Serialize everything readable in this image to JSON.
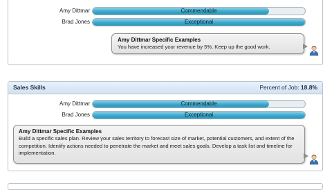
{
  "top_section": {
    "ratings": [
      {
        "name": "Amy Dittmar",
        "rating": "Commendable",
        "level": 0.83
      },
      {
        "name": "Brad Jones",
        "rating": "Exceptional",
        "level": 1.0
      }
    ],
    "comment": {
      "title": "Amy Dittmar Specific Examples",
      "text": "You have increased your revenue by 5%. Keep up the good work."
    }
  },
  "sales_section": {
    "title": "Sales Skills",
    "percent_label": "Percent of Job:",
    "percent_value": "18.8%",
    "ratings": [
      {
        "name": "Amy Dittmar",
        "rating": "Commendable",
        "level": 0.83
      },
      {
        "name": "Brad Jones",
        "rating": "Exceptional",
        "level": 1.0
      }
    ],
    "comment": {
      "title": "Amy Dittmar Specific Examples",
      "text": "Build a specific sales plan. Review your sales territory to forecast size of market, potential customers, and extent of the competition. Identify actions needed to penetrate the market and meet sales goals. Develop a task list and timeline for implementation."
    }
  },
  "icons": {
    "avatar": "user-avatar-icon"
  },
  "colors": {
    "bar_fill": "#3ba9cc",
    "header_bg": "#d3e2f1",
    "bubble_bg": "#e8e8e8"
  }
}
